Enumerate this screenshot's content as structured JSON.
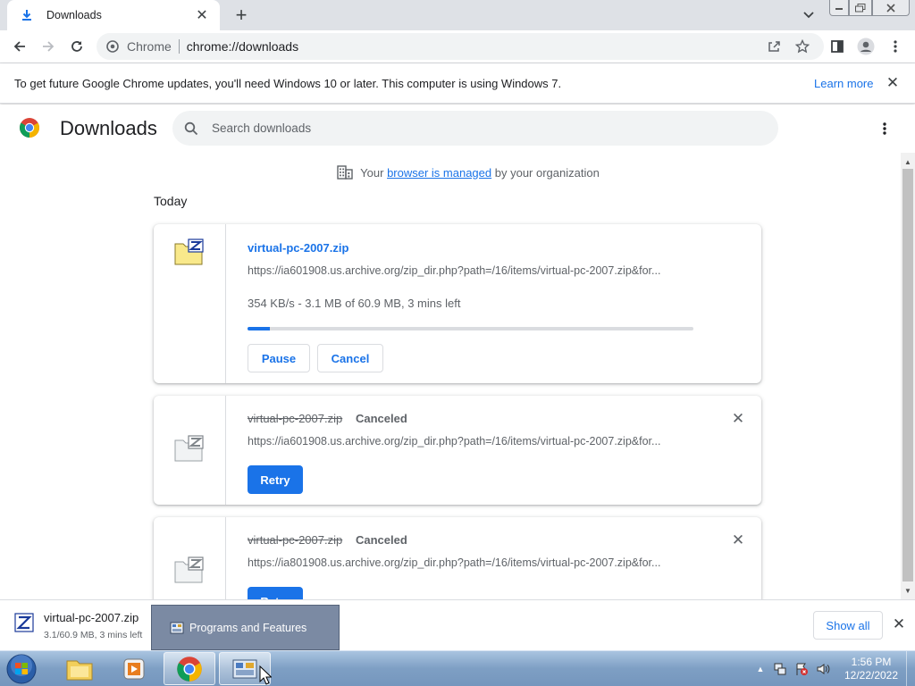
{
  "tab": {
    "title": "Downloads",
    "favicon": "download-icon"
  },
  "toolbar": {
    "chip_label": "Chrome",
    "url": "chrome://downloads"
  },
  "infobar": {
    "message": "To get future Google Chrome updates, you'll need Windows 10 or later. This computer is using Windows 7.",
    "link_label": "Learn more"
  },
  "header": {
    "title": "Downloads",
    "search_placeholder": "Search downloads"
  },
  "managed": {
    "prefix": "Your",
    "link": "browser is managed",
    "suffix": "by your organization"
  },
  "date_header": "Today",
  "downloads": [
    {
      "name": "virtual-pc-2007.zip",
      "url": "https://ia601908.us.archive.org/zip_dir.php?path=/16/items/virtual-pc-2007.zip&for...",
      "progress_text": "354 KB/s - 3.1 MB of 60.9 MB, 3 mins left",
      "progress_fraction": 0.05,
      "buttons": {
        "pause": "Pause",
        "cancel": "Cancel"
      }
    },
    {
      "name": "virtual-pc-2007.zip",
      "status": "Canceled",
      "url": "https://ia601908.us.archive.org/zip_dir.php?path=/16/items/virtual-pc-2007.zip&for...",
      "retry": "Retry"
    },
    {
      "name": "virtual-pc-2007.zip",
      "status": "Canceled",
      "url": "https://ia801908.us.archive.org/zip_dir.php?path=/16/items/virtual-pc-2007.zip&for...",
      "retry": "Retry"
    }
  ],
  "shelf": {
    "item_name": "virtual-pc-2007.zip",
    "item_status": "3.1/60.9 MB, 3 mins left",
    "show_all": "Show all",
    "tooltip": "Programs and Features"
  },
  "taskbar": {
    "time": "1:56 PM",
    "date": "12/22/2022"
  },
  "colors": {
    "accent": "#1a73e8",
    "text": "#202124",
    "muted": "#5f6368",
    "taskbar": "#7e9fc4"
  }
}
